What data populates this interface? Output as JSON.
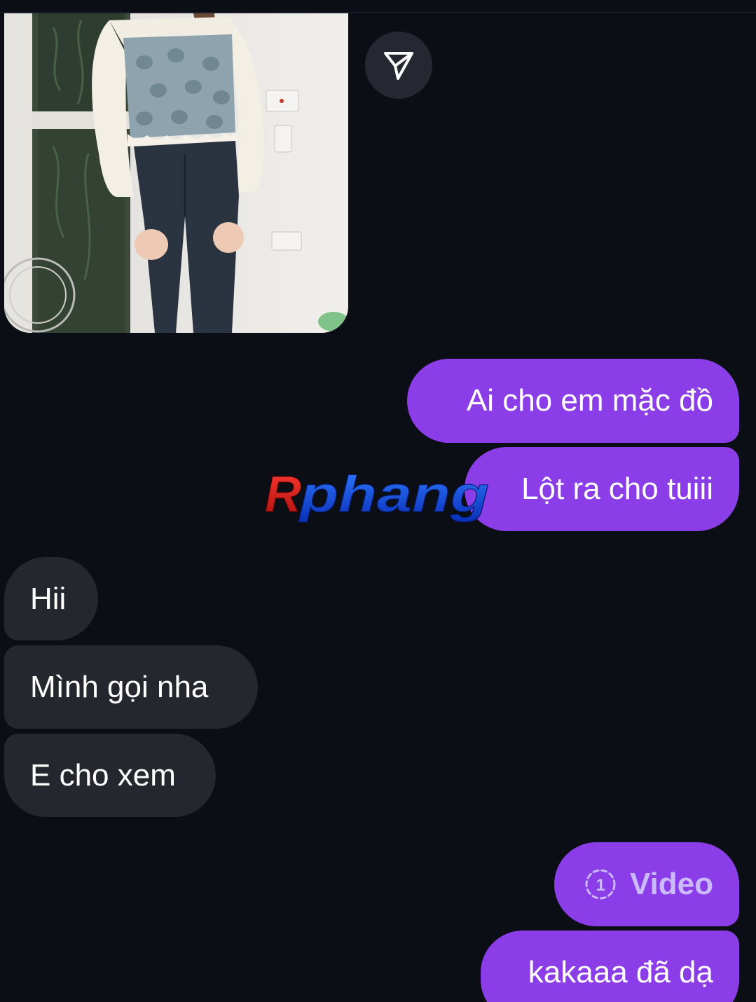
{
  "photo_message": {
    "share_icon": "send-paper-plane-icon"
  },
  "messages": [
    {
      "direction": "out",
      "text": "Ai cho em mặc đồ"
    },
    {
      "direction": "out",
      "text": "Lột ra cho tuiii"
    },
    {
      "direction": "in",
      "text": "Hii"
    },
    {
      "direction": "in",
      "text": "Mình gọi nha"
    },
    {
      "direction": "in",
      "text": "E cho xem"
    },
    {
      "direction": "out",
      "type": "view-once-video",
      "icon": "view-once-1-icon",
      "badge_digit": "1",
      "text": "Video"
    },
    {
      "direction": "out",
      "text": "kakaaa đã dạ"
    }
  ],
  "watermark": {
    "text": "Rphang"
  },
  "colors": {
    "background": "#0b0e15",
    "outgoing_bubble": "#8b3ee8",
    "outgoing_video_bubble": "#7a47ef",
    "incoming_bubble": "#24272e",
    "video_label": "#cbbafd"
  }
}
